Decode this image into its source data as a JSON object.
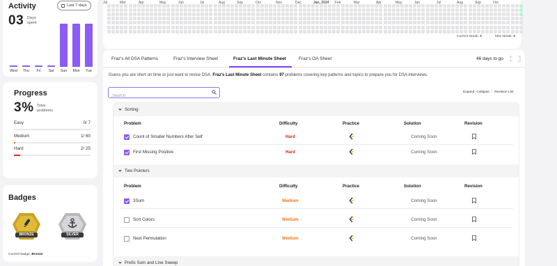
{
  "activity": {
    "title": "Activity",
    "range_button": "Last 7 days",
    "days_value": "03",
    "days_label_line1": "Days",
    "days_label_line2": "spent",
    "bars": [
      {
        "day": "Wed",
        "value": 0.04
      },
      {
        "day": "Thu",
        "value": 0.04
      },
      {
        "day": "Fri",
        "value": 0.04
      },
      {
        "day": "Sat",
        "value": 0.04
      },
      {
        "day": "Sun",
        "value": 1.0
      },
      {
        "day": "Mon",
        "value": 1.0
      },
      {
        "day": "Tue",
        "value": 1.0
      }
    ]
  },
  "progress": {
    "title": "Progress",
    "percent": "3%",
    "label_line1": "Total",
    "label_line2": "problems",
    "rows": [
      {
        "label": "Easy",
        "count": "0/ 7",
        "fraction": 0.0,
        "color": "#22c55e"
      },
      {
        "label": "Medium",
        "count": "1/ 60",
        "fraction": 0.017,
        "color": "#f97316"
      },
      {
        "label": "Hard",
        "count": "2/ 25",
        "fraction": 0.08,
        "color": "#dc2626"
      }
    ]
  },
  "badges": {
    "title": "Badges",
    "items": [
      {
        "label": "BRONZE",
        "icon": "pencil-icon"
      },
      {
        "label": "SILVER",
        "icon": "anchor-icon"
      }
    ],
    "current_prefix": "Current badge:",
    "current_value": "Bronze"
  },
  "heatmap": {
    "months": [
      "Jul",
      "Mar",
      "Apr",
      "May",
      "Jun",
      "Jul",
      "Aug",
      "Sep",
      "Oct",
      "Nov",
      "Dec",
      "Jan, 2024",
      "Feb",
      "Mar",
      "Apr",
      "May",
      "Jun",
      "Jul",
      "Aug",
      "Sep",
      "Oct"
    ],
    "current_streak_label": "Current streak:",
    "current_streak_value": "3",
    "max_streak_label": "Max streak:",
    "max_streak_value": "3",
    "empty_color": "#e4e4e6",
    "active_color": "#bff0d4"
  },
  "tabs": [
    {
      "label": "Fraz's All DSA Patterns",
      "active": false
    },
    {
      "label": "Fraz's Interview Sheet",
      "active": false
    },
    {
      "label": "Fraz's Last Minute Sheet",
      "active": true
    },
    {
      "label": "Fraz's OA Sheet",
      "active": false
    }
  ],
  "days_to_go": "46 days to go",
  "description": {
    "part1": "Guess you are short on time or just want to revise DSA. ",
    "bold1": "Fraz's Last Minute Sheet",
    "part2": " contains ",
    "bold2": "97",
    "part3": " problems covering key patterns and topics to prepare you for DSA interviews."
  },
  "search": {
    "placeholder": "Search",
    "value": ""
  },
  "actions": {
    "expand": "Expand",
    "collapse": "Collapse",
    "revision": "Revision List"
  },
  "columns": {
    "problem": "Problem",
    "difficulty": "Difficulty",
    "practice": "Practice",
    "solution": "Solution",
    "revision": "Revision"
  },
  "sections": [
    {
      "name": "Sorting",
      "problems": [
        {
          "name": "Count of Smaller Numbers After Self",
          "difficulty": "Hard",
          "checked": true,
          "solution": "Coming Soon"
        },
        {
          "name": "First Missing Positive",
          "difficulty": "Hard",
          "checked": true,
          "solution": "Coming Soon"
        }
      ]
    },
    {
      "name": "Two Pointers",
      "problems": [
        {
          "name": "3Sum",
          "difficulty": "Medium",
          "checked": true,
          "solution": "Coming Soon"
        },
        {
          "name": "Sort Colors",
          "difficulty": "Medium",
          "checked": false,
          "solution": "Coming Soon"
        },
        {
          "name": "Next Permutation",
          "difficulty": "Medium",
          "checked": false,
          "solution": "Coming Soon"
        }
      ]
    },
    {
      "name": "Prefix Sum and Line Sweep",
      "problems": []
    }
  ],
  "colors": {
    "accent": "#8b5cf6",
    "hard": "#dc2626",
    "medium": "#f97316"
  }
}
